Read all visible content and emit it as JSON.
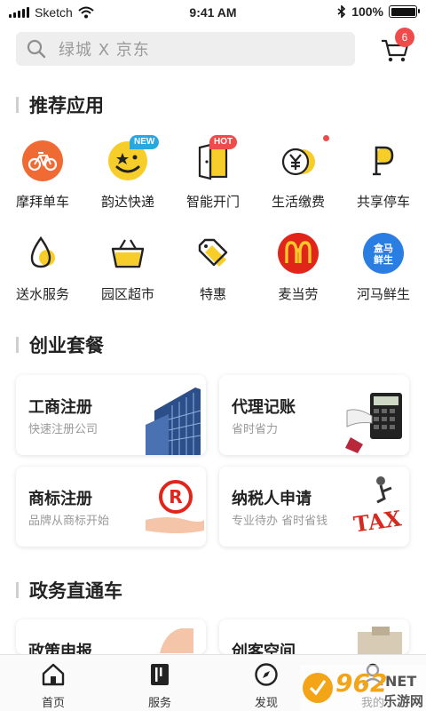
{
  "status_bar": {
    "carrier": "Sketch",
    "time": "9:41 AM",
    "battery": "100%"
  },
  "search": {
    "placeholder": "绿城 X 京东"
  },
  "cart": {
    "badge_count": "6"
  },
  "sections": {
    "recommended": "推荐应用",
    "startup": "创业套餐",
    "gov": "政务直通车"
  },
  "apps": [
    {
      "label": "摩拜单车",
      "icon": "bike-icon"
    },
    {
      "label": "韵达快递",
      "icon": "courier-icon",
      "tag": "NEW"
    },
    {
      "label": "智能开门",
      "icon": "door-icon",
      "tag": "HOT"
    },
    {
      "label": "生活缴费",
      "icon": "yen-coin-icon"
    },
    {
      "label": "共享停车",
      "icon": "parking-icon"
    },
    {
      "label": "送水服务",
      "icon": "water-drop-icon"
    },
    {
      "label": "园区超市",
      "icon": "basket-icon"
    },
    {
      "label": "特惠",
      "icon": "price-tag-icon"
    },
    {
      "label": "麦当劳",
      "icon": "mcdonalds-icon"
    },
    {
      "label": "河马鲜生",
      "icon": "hema-icon",
      "logo_text": [
        "盒马",
        "鲜生"
      ]
    }
  ],
  "startup_cards": [
    {
      "title": "工商注册",
      "subtitle": "快速注册公司",
      "icon": "office-building-icon"
    },
    {
      "title": "代理记账",
      "subtitle": "省时省力",
      "icon": "calculator-icon"
    },
    {
      "title": "商标注册",
      "subtitle": "品牌从商标开始",
      "icon": "registered-trademark-icon"
    },
    {
      "title": "纳税人申请",
      "subtitle": "专业待办 省时省钱",
      "icon": "tax-icon",
      "pic_text": "TAX"
    }
  ],
  "gov_cards": [
    {
      "title": "政策申报",
      "icon": "hand-icon"
    },
    {
      "title": "创客空间",
      "icon": "workspace-icon"
    }
  ],
  "tabbar": [
    {
      "label": "首页",
      "icon": "home-icon"
    },
    {
      "label": "服务",
      "icon": "service-icon"
    },
    {
      "label": "发现",
      "icon": "compass-icon"
    },
    {
      "label": "我的",
      "icon": "profile-icon"
    }
  ],
  "watermark": {
    "text": "962",
    "suffix": "NET",
    "sub": "乐游网"
  },
  "colors": {
    "accent_red": "#ef4b4b",
    "yellow": "#f7cd2a",
    "orange": "#f06a33",
    "blue": "#2a7de1"
  }
}
